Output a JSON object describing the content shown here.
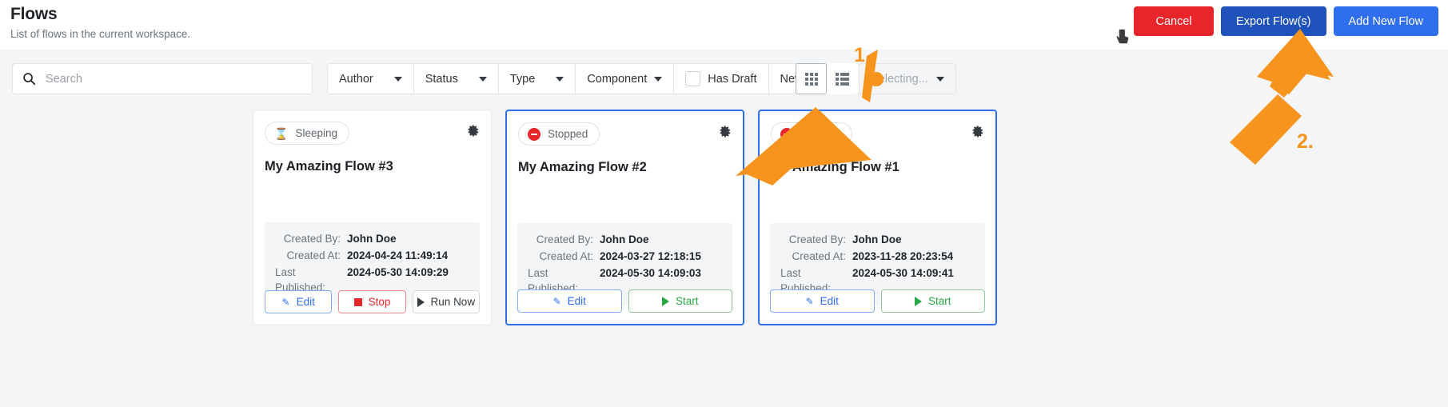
{
  "header": {
    "title": "Flows",
    "subtitle": "List of flows in the current workspace.",
    "buttons": {
      "cancel": "Cancel",
      "export": "Export Flow(s)",
      "add": "Add New Flow"
    },
    "colors": {
      "cancel": "#e8252a",
      "export": "#1f52ba",
      "add": "#2f6fed"
    }
  },
  "toolbar": {
    "search": {
      "value": "",
      "placeholder": "Search",
      "icon": "search-icon"
    },
    "filters": [
      {
        "label": "Author",
        "icon": "chevron-down-icon"
      },
      {
        "label": "Status",
        "icon": "chevron-down-icon"
      },
      {
        "label": "Type",
        "icon": "chevron-down-icon"
      },
      {
        "label": "Component",
        "icon": "chevron-down-icon"
      },
      {
        "label": "Has Draft",
        "icon": "checkbox-icon",
        "checked": false
      },
      {
        "label": "Newest",
        "icon": "chevron-down-icon"
      }
    ],
    "view": {
      "grid_label": "grid-view",
      "list_label": "list-view",
      "active": "grid"
    },
    "selecting": {
      "label": "Selecting...",
      "icon": "chevron-down-icon",
      "disabled": true
    }
  },
  "cards": [
    {
      "status": "Sleeping",
      "status_icon": "hourglass-icon",
      "status_color": "#f7941e",
      "title": "My Amazing Flow #3",
      "selected": false,
      "meta": [
        {
          "label": "Created By:",
          "value": "John Doe"
        },
        {
          "label": "Created At:",
          "value": "2024-04-24 11:49:14"
        },
        {
          "label": "Last Published:",
          "value": "2024-05-30 14:09:29"
        }
      ],
      "actions": [
        {
          "label": "Edit",
          "icon": "pencil-icon",
          "style": "edit"
        },
        {
          "label": "Stop",
          "icon": "stop-square-icon",
          "style": "stop"
        },
        {
          "label": "Run Now",
          "icon": "play-icon",
          "style": "run"
        }
      ]
    },
    {
      "status": "Stopped",
      "status_icon": "stopped-circle-icon",
      "status_color": "#e8252a",
      "title": "My Amazing Flow #2",
      "selected": true,
      "meta": [
        {
          "label": "Created By:",
          "value": "John Doe"
        },
        {
          "label": "Created At:",
          "value": "2024-03-27 12:18:15"
        },
        {
          "label": "Last Published:",
          "value": "2024-05-30 14:09:03"
        }
      ],
      "actions": [
        {
          "label": "Edit",
          "icon": "pencil-icon",
          "style": "edit"
        },
        {
          "label": "Start",
          "icon": "play-icon",
          "style": "start"
        }
      ]
    },
    {
      "status": "Stopped",
      "status_icon": "stopped-circle-icon",
      "status_color": "#e8252a",
      "title": "My Amazing Flow #1",
      "selected": true,
      "meta": [
        {
          "label": "Created By:",
          "value": "John Doe"
        },
        {
          "label": "Created At:",
          "value": "2023-11-28 20:23:54"
        },
        {
          "label": "Last Published:",
          "value": "2024-05-30 14:09:41"
        }
      ],
      "actions": [
        {
          "label": "Edit",
          "icon": "pencil-icon",
          "style": "edit"
        },
        {
          "label": "Start",
          "icon": "play-icon",
          "style": "start"
        }
      ]
    }
  ],
  "annotations": {
    "color": "#f7941e",
    "step_one": "1.",
    "step_two": "2."
  }
}
